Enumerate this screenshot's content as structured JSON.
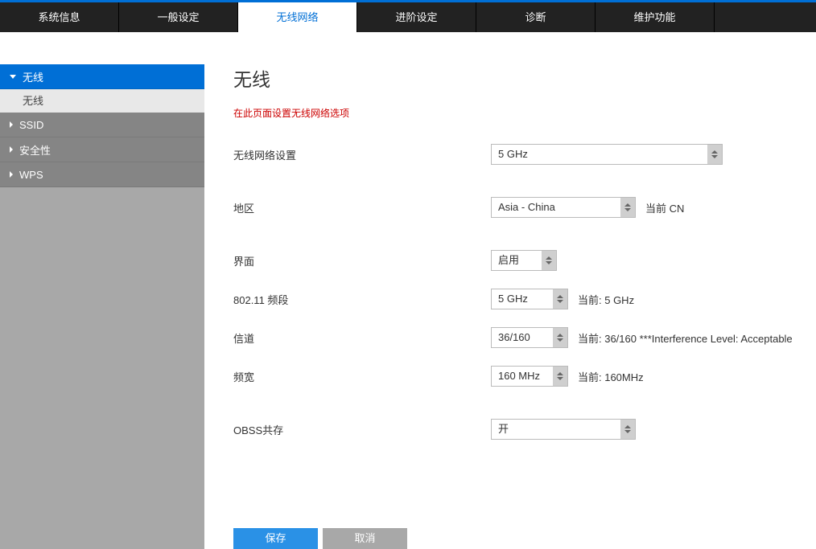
{
  "topnav": {
    "items": [
      {
        "label": "系统信息"
      },
      {
        "label": "一般设定"
      },
      {
        "label": "无线网络"
      },
      {
        "label": "进阶设定"
      },
      {
        "label": "诊断"
      },
      {
        "label": "维护功能"
      }
    ],
    "active_index": 2
  },
  "sidebar": {
    "sections": [
      {
        "label": "无线",
        "expanded": true,
        "sub": [
          {
            "label": "无线"
          }
        ]
      },
      {
        "label": "SSID"
      },
      {
        "label": "安全性"
      },
      {
        "label": "WPS"
      }
    ]
  },
  "page": {
    "title": "无线",
    "desc": "在此页面设置无线网络选项"
  },
  "form": {
    "wireless_setting": {
      "label": "无线网络设置",
      "value": "5 GHz"
    },
    "region": {
      "label": "地区",
      "value": "Asia - China",
      "hint": "当前 CN"
    },
    "interface": {
      "label": "界面",
      "value": "启用"
    },
    "band": {
      "label": "802.11 频段",
      "value": "5 GHz",
      "hint": "当前: 5 GHz"
    },
    "channel": {
      "label": "信道",
      "value": "36/160",
      "hint": "当前: 36/160 ***Interference Level: Acceptable"
    },
    "width": {
      "label": "频宽",
      "value": "160 MHz",
      "hint": "当前: 160MHz"
    },
    "obss": {
      "label": "OBSS共存",
      "value": "开"
    }
  },
  "buttons": {
    "save": "保存",
    "cancel": "取消"
  }
}
